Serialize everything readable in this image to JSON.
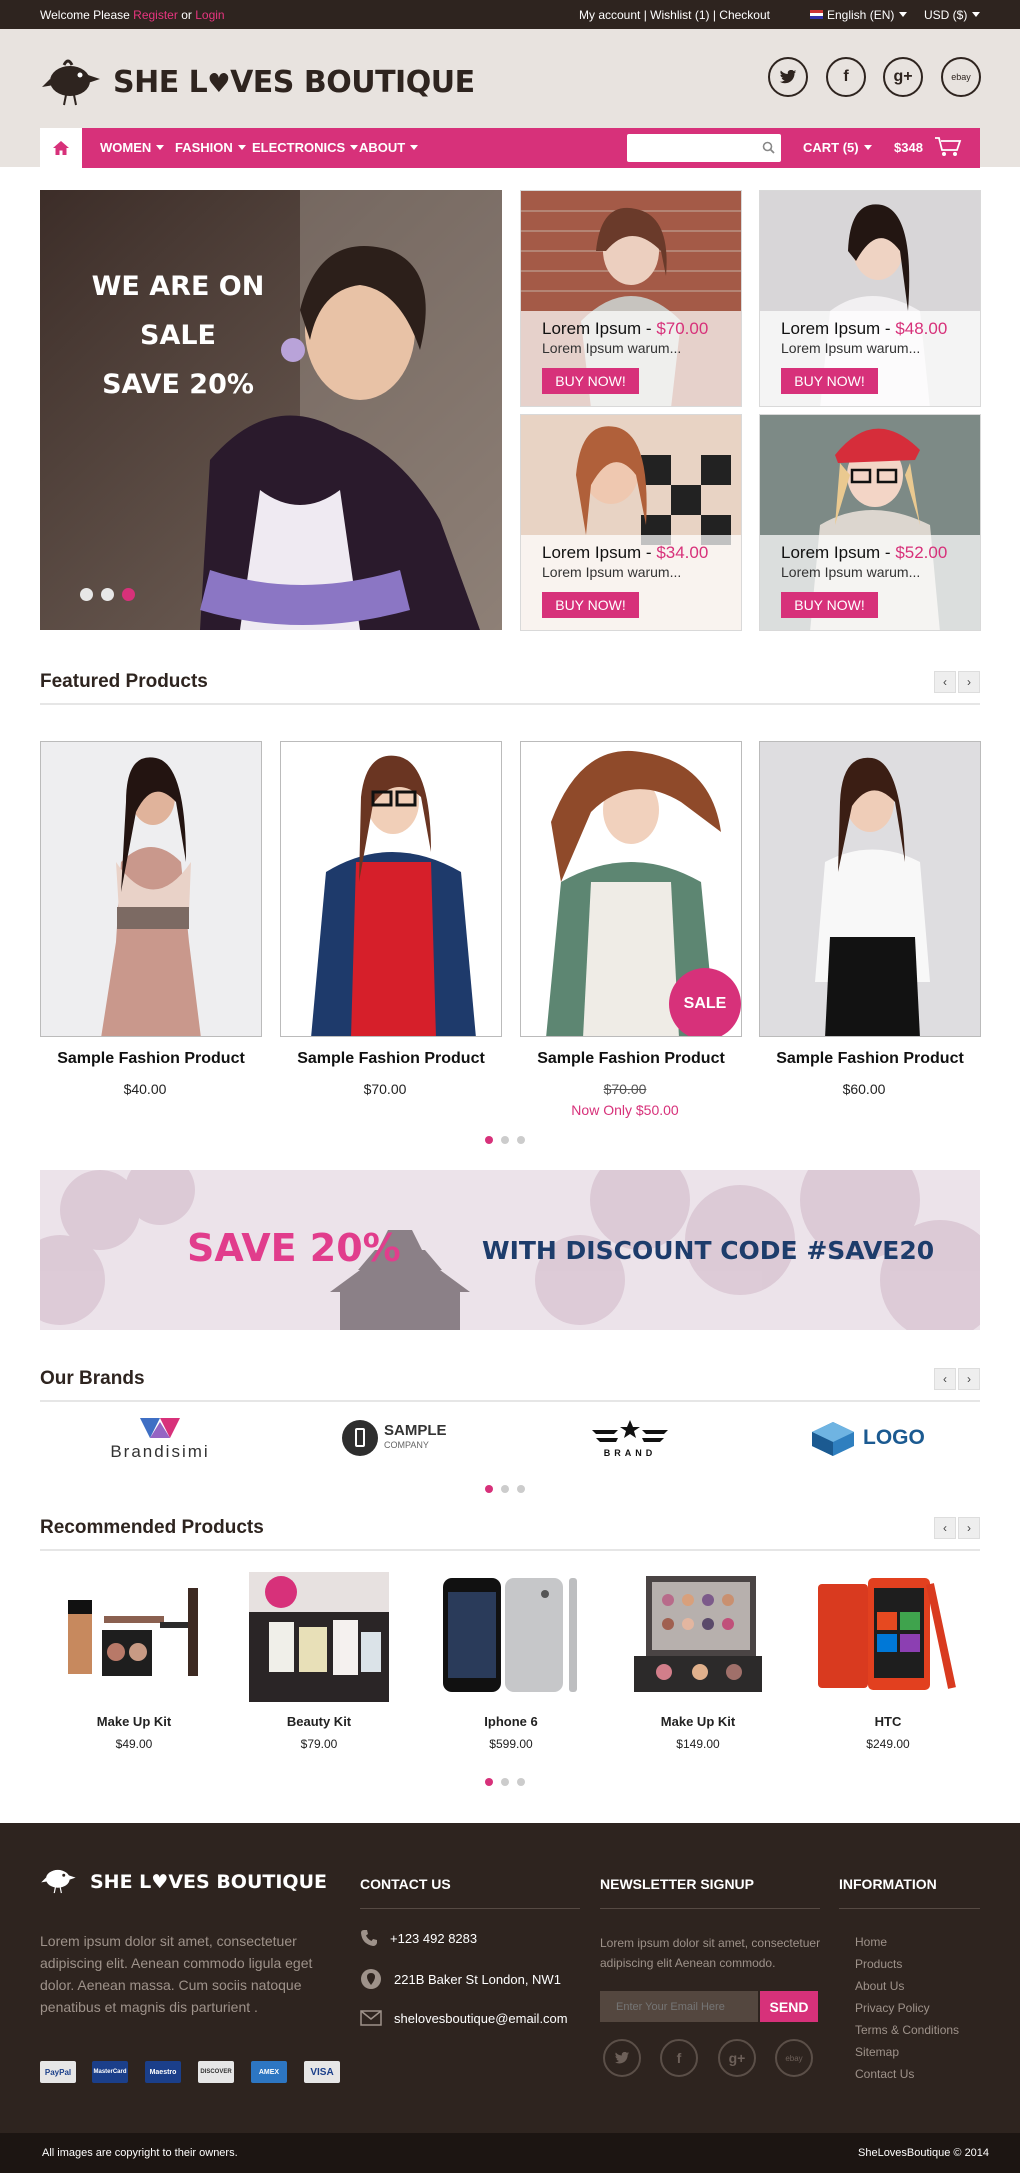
{
  "topbar": {
    "welcome_prefix": "Welcome Please",
    "register": "Register",
    "or": "or",
    "login": "Login",
    "my_account": "My account",
    "wishlist": "Wishlist (1)",
    "checkout": "Checkout",
    "language": "English (EN)",
    "currency": "USD ($)"
  },
  "header": {
    "logo_she": "SHE L",
    "logo_rest": "VES BOUTIQUE",
    "social": [
      "twitter-icon",
      "facebook-icon",
      "googleplus-icon",
      "ebay-icon"
    ],
    "social_labels": [
      "t",
      "f",
      "g+",
      "ebay"
    ]
  },
  "nav": {
    "items": [
      "WOMEN",
      "FASHION",
      "ELECTRONICS",
      "ABOUT"
    ],
    "search_placeholder": "",
    "cart": "CART (5)",
    "cart_total": "$348"
  },
  "hero": {
    "line1": "WE ARE ON SALE",
    "line2": "SAVE 20%",
    "slides": 3,
    "active_slide": 3
  },
  "promos": [
    {
      "title": "Lorem Ipsum",
      "price": "$70.00",
      "desc": "Lorem Ipsum warum...",
      "button": "BUY NOW!"
    },
    {
      "title": "Lorem Ipsum",
      "price": "$48.00",
      "desc": "Lorem Ipsum warum...",
      "button": "BUY NOW!"
    },
    {
      "title": "Lorem Ipsum",
      "price": "$34.00",
      "desc": "Lorem Ipsum warum...",
      "button": "BUY NOW!"
    },
    {
      "title": "Lorem Ipsum",
      "price": "$52.00",
      "desc": "Lorem Ipsum warum...",
      "button": "BUY NOW!"
    }
  ],
  "featured": {
    "heading": "Featured Products",
    "products": [
      {
        "name": "Sample Fashion Product",
        "price": "$40.00"
      },
      {
        "name": "Sample Fashion Product",
        "price": "$70.00"
      },
      {
        "name": "Sample Fashion Product",
        "old_price": "$70.00",
        "sale_price": "Now Only $50.00",
        "badge": "SALE"
      },
      {
        "name": "Sample Fashion Product",
        "price": "$60.00"
      }
    ]
  },
  "banner": {
    "save": "SAVE 20%",
    "code": "WITH DISCOUNT CODE #SAVE20"
  },
  "brands": {
    "heading": "Our Brands",
    "items": [
      "Brandisimi",
      "SAMPLE",
      "COMPANY",
      "BRAND",
      "LOGO"
    ]
  },
  "recommended": {
    "heading": "Recommended Products",
    "products": [
      {
        "name": "Make Up Kit",
        "price": "$49.00"
      },
      {
        "name": "Beauty Kit",
        "price": "$79.00"
      },
      {
        "name": "Iphone 6",
        "price": "$599.00"
      },
      {
        "name": "Make Up Kit",
        "price": "$149.00"
      },
      {
        "name": "HTC",
        "price": "$249.00"
      }
    ]
  },
  "footer": {
    "about": "Lorem ipsum dolor sit amet, consectetuer adipiscing elit. Aenean commodo ligula eget dolor. Aenean massa. Cum sociis natoque penatibus et magnis dis parturient .",
    "contact_heading": "CONTACT US",
    "phone": "+123 492 8283",
    "address": "221B Baker St London, NW1",
    "email": "shelovesboutique@email.com",
    "newsletter_heading": "NEWSLETTER SIGNUP",
    "newsletter_text": "Lorem ipsum dolor sit amet, consectetuer adipiscing elit Aenean commodo.",
    "email_placeholder": "Enter Your Email Here",
    "send": "SEND",
    "info_heading": "INFORMATION",
    "info_links": [
      "Home",
      "Products",
      "About Us",
      "Privacy Policy",
      "Terms & Conditions",
      "Sitemap",
      "Contact Us"
    ],
    "payments": [
      "PayPal",
      "MasterCard",
      "Maestro",
      "DISCOVER",
      "AMEX",
      "VISA"
    ],
    "copyright_left": "All images are copyright to their owners.",
    "copyright_right": "SheLovesBoutique © 2014"
  },
  "colors": {
    "accent": "#d7317a",
    "dark": "#2e241f",
    "header_bg": "#e8e3df"
  }
}
